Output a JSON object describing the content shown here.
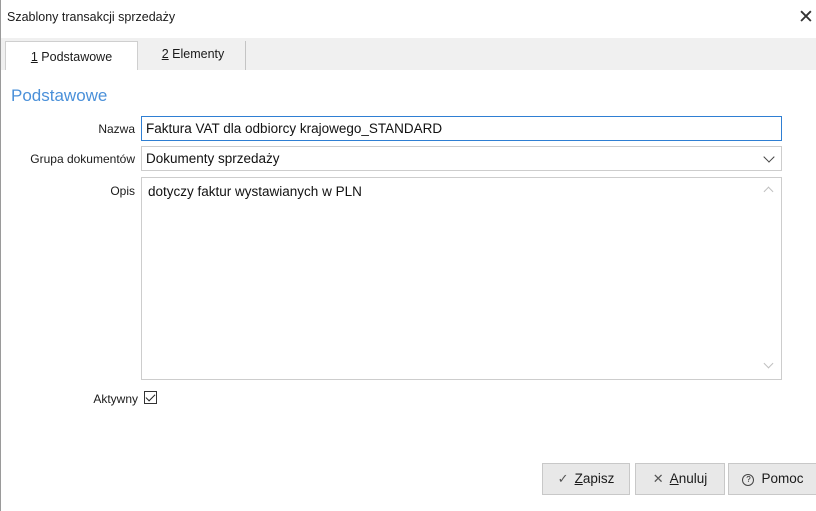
{
  "window": {
    "title": "Szablony transakcji sprzedaży",
    "close_glyph": "✕"
  },
  "tabs": [
    {
      "key": "1",
      "label": "Podstawowe",
      "active": true
    },
    {
      "key": "2",
      "label": "Elementy",
      "active": false
    }
  ],
  "section": {
    "title": "Podstawowe"
  },
  "form": {
    "name_label": "Nazwa",
    "name_value": "Faktura VAT dla odbiorcy krajowego_STANDARD",
    "group_label": "Grupa dokumentów",
    "group_value": "Dokumenty sprzedaży",
    "desc_label": "Opis",
    "desc_value": "dotyczy faktur wystawianych w PLN",
    "active_label": "Aktywny",
    "active_checked": true
  },
  "buttons": {
    "save": {
      "key": "Z",
      "rest": "apisz",
      "icon": "check-icon"
    },
    "cancel": {
      "key": "A",
      "rest": "nuluj",
      "icon": "close-icon"
    },
    "help": {
      "label": "Pomoc",
      "icon": "help-icon"
    }
  },
  "colors": {
    "accent": "#4a90d9",
    "focus_border": "#2f7fd3",
    "tabstrip_bg": "#f0f0f0",
    "button_bg": "#e8e8e8"
  }
}
